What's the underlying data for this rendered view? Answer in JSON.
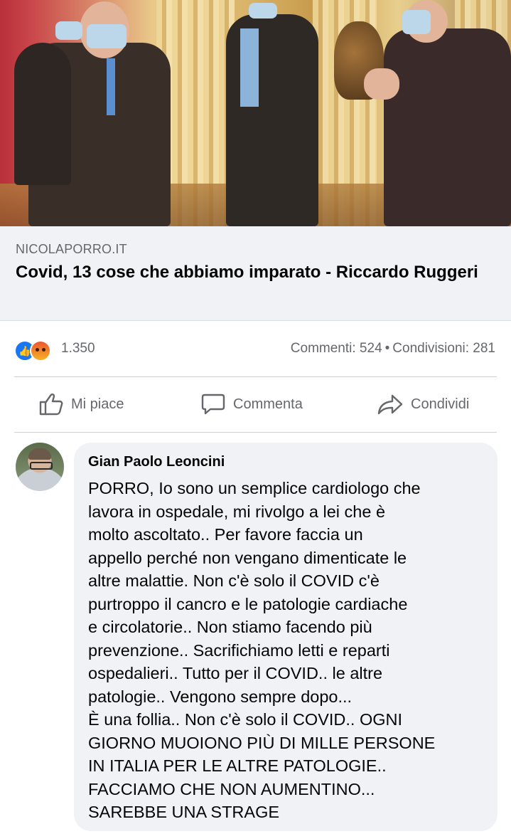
{
  "link_preview": {
    "domain": "NICOLAPORRO.IT",
    "title": "Covid, 13 cose che abbiamo imparato - Riccardo Ruggeri"
  },
  "reactions": {
    "icons": [
      "like-icon",
      "angry-icon"
    ],
    "count": "1.350",
    "comments": "Commenti: 524",
    "separator": "•",
    "shares": "Condivisioni: 281",
    "colors": {
      "like": "#1877f2",
      "angry": "#f0643a"
    }
  },
  "actions": {
    "like": {
      "label": "Mi piace",
      "icon": "thumbs-up-icon"
    },
    "comment": {
      "label": "Commenta",
      "icon": "speech-bubble-icon"
    },
    "share": {
      "label": "Condividi",
      "icon": "share-arrow-icon"
    }
  },
  "comment": {
    "author": "Gian Paolo Leoncini",
    "lines": [
      "PORRO,  Io sono un semplice cardiologo che",
      "lavora in ospedale, mi rivolgo a lei che è",
      "molto ascoltato.. Per favore faccia un",
      "appello perché non vengano dimenticate le",
      "altre malattie. Non c'è solo il COVID c'è",
      "purtroppo il cancro e le patologie cardiache",
      "e circolatorie.. Non stiamo facendo più",
      "prevenzione.. Sacrifichiamo letti e reparti",
      "ospedalieri.. Tutto per il COVID.. le altre",
      "patologie.. Vengono sempre dopo...",
      "È una follia.. Non c'è solo il COVID.. OGNI",
      "GIORNO MUOIONO PIÙ DI MILLE PERSONE",
      "IN ITALIA PER LE ALTRE PATOLOGIE..",
      "FACCIAMO CHE NON AUMENTINO...",
      "SAREBBE UNA STRAGE"
    ]
  }
}
